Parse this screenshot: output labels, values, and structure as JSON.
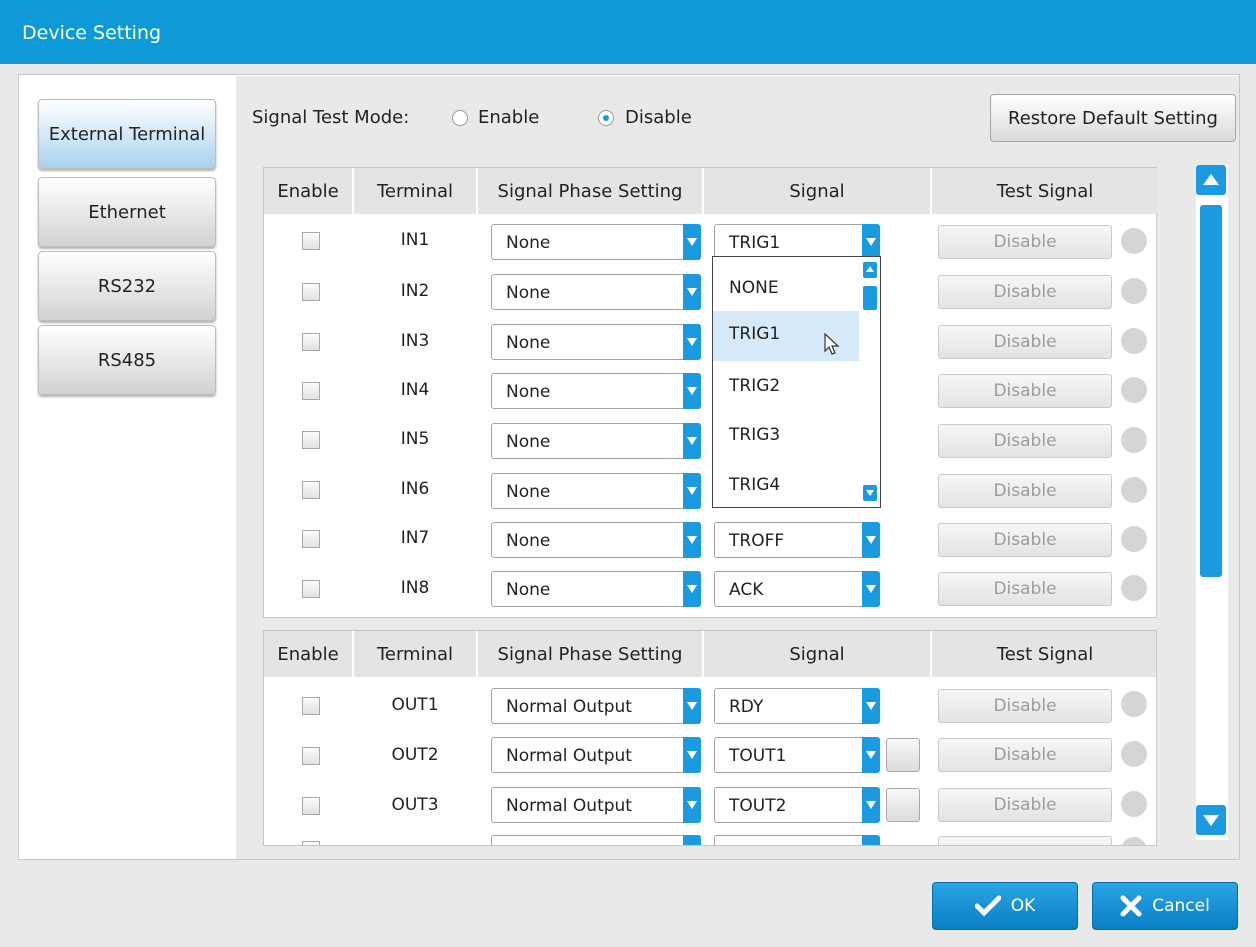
{
  "window": {
    "title": "Device Setting"
  },
  "tabs": [
    {
      "label": "External Terminal",
      "active": true
    },
    {
      "label": "Ethernet",
      "active": false
    },
    {
      "label": "RS232",
      "active": false
    },
    {
      "label": "RS485",
      "active": false
    }
  ],
  "signal_test_mode": {
    "label": "Signal Test Mode:",
    "options": [
      {
        "label": "Enable",
        "checked": false
      },
      {
        "label": "Disable",
        "checked": true
      }
    ]
  },
  "restore_button": "Restore Default Setting",
  "table_headers": {
    "enable": "Enable",
    "terminal": "Terminal",
    "phase": "Signal Phase Setting",
    "signal": "Signal",
    "test": "Test Signal"
  },
  "input_rows": [
    {
      "terminal": "IN1",
      "phase": "None",
      "signal": "TRIG1",
      "test": "Disable"
    },
    {
      "terminal": "IN2",
      "phase": "None",
      "signal": "",
      "test": "Disable"
    },
    {
      "terminal": "IN3",
      "phase": "None",
      "signal": "",
      "test": "Disable"
    },
    {
      "terminal": "IN4",
      "phase": "None",
      "signal": "",
      "test": "Disable"
    },
    {
      "terminal": "IN5",
      "phase": "None",
      "signal": "",
      "test": "Disable"
    },
    {
      "terminal": "IN6",
      "phase": "None",
      "signal": "",
      "test": "Disable"
    },
    {
      "terminal": "IN7",
      "phase": "None",
      "signal": "TROFF",
      "test": "Disable"
    },
    {
      "terminal": "IN8",
      "phase": "None",
      "signal": "ACK",
      "test": "Disable"
    }
  ],
  "output_rows": [
    {
      "terminal": "OUT1",
      "phase": "Normal Output",
      "signal": "RDY",
      "test": "Disable"
    },
    {
      "terminal": "OUT2",
      "phase": "Normal Output",
      "signal": "TOUT1",
      "test": "Disable"
    },
    {
      "terminal": "OUT3",
      "phase": "Normal Output",
      "signal": "TOUT2",
      "test": "Disable"
    }
  ],
  "signal_dropdown": {
    "items": [
      "NONE",
      "TRIG1",
      "TRIG2",
      "TRIG3",
      "TRIG4"
    ],
    "hovered": "TRIG1"
  },
  "buttons": {
    "ok": "OK",
    "cancel": "Cancel"
  },
  "colors": {
    "accent": "#0e9ad8",
    "scroll": "#1a9be0",
    "hover": "#d5e9f8"
  }
}
